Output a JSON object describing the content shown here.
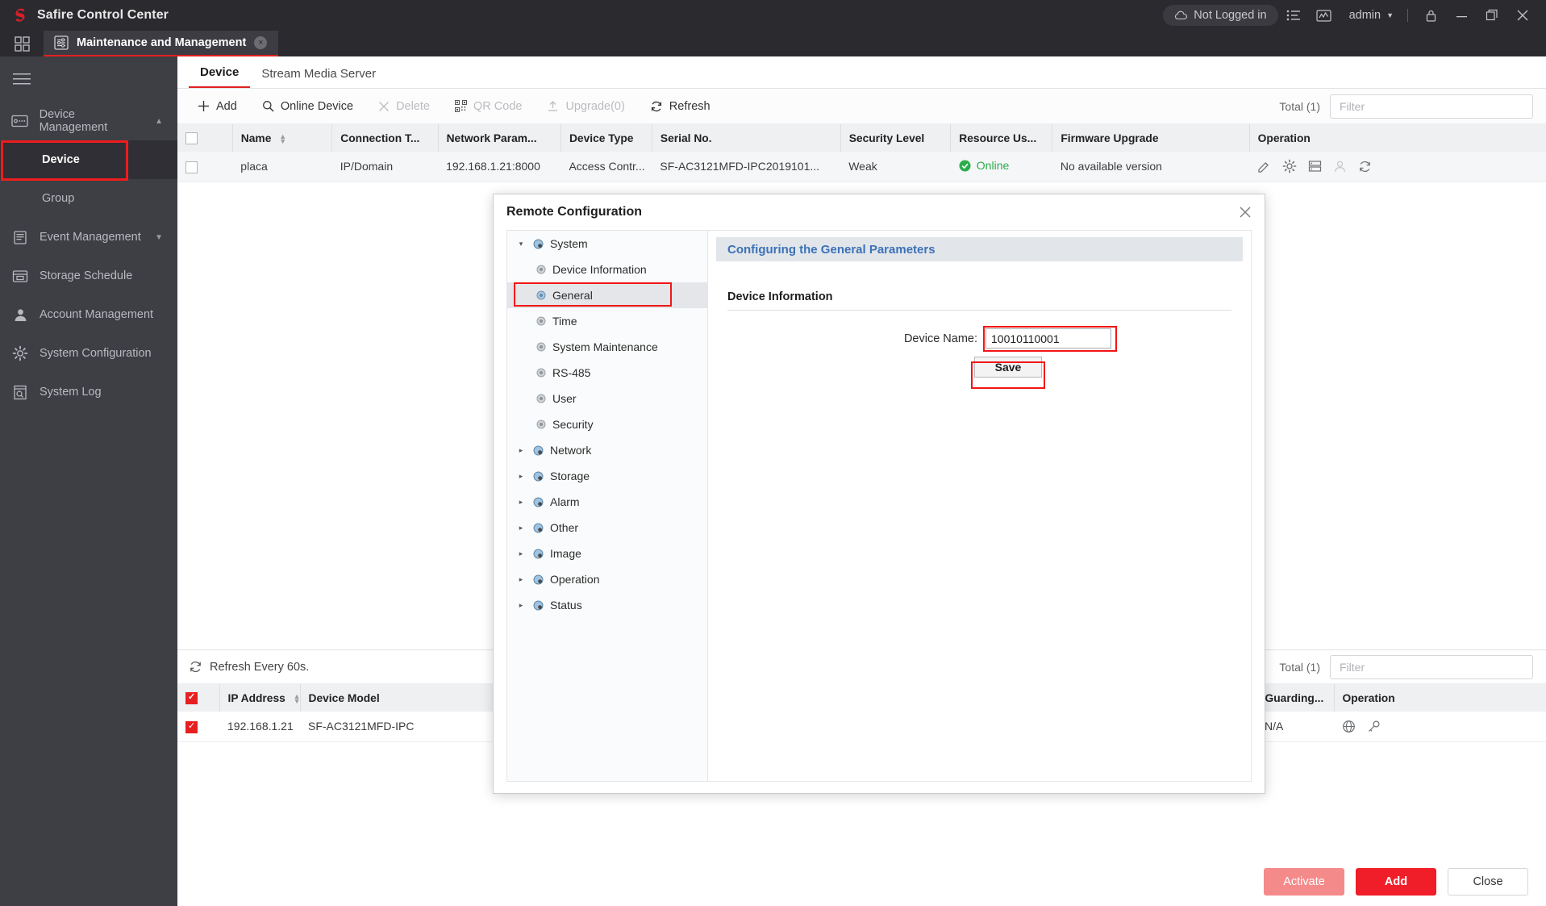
{
  "titlebar": {
    "app_title": "Safire Control Center",
    "logo_icon": "safire-s-logo",
    "cloud_status": "Not Logged in",
    "cloud_icon": "cloud-icon",
    "list_icon": "list-icon",
    "chart_icon": "chart-icon",
    "user_name": "admin",
    "lock_icon": "lock-icon",
    "minimize_icon": "minimize-icon",
    "maximize_icon": "maximize-icon",
    "close_icon": "close-icon"
  },
  "tabstrip": {
    "apps_icon": "grid-apps-icon",
    "tab_icon": "maintenance-icon",
    "tab_label": "Maintenance and Management",
    "tab_close": "×"
  },
  "sidebar": {
    "menu_icon": "hamburger-icon",
    "items": [
      {
        "label": "Device Management",
        "icon": "device-management-icon",
        "expanded": true,
        "caret": "▲"
      },
      {
        "label": "Device",
        "icon": "",
        "sub": true,
        "active": true
      },
      {
        "label": "Group",
        "icon": "",
        "sub": true,
        "active": false
      },
      {
        "label": "Event Management",
        "icon": "event-management-icon",
        "expanded": false,
        "caret": "▼"
      },
      {
        "label": "Storage Schedule",
        "icon": "storage-schedule-icon"
      },
      {
        "label": "Account Management",
        "icon": "account-management-icon"
      },
      {
        "label": "System Configuration",
        "icon": "system-configuration-icon"
      },
      {
        "label": "System Log",
        "icon": "system-log-icon"
      }
    ]
  },
  "content": {
    "tabs": [
      {
        "label": "Device",
        "active": true
      },
      {
        "label": "Stream Media Server",
        "active": false
      }
    ],
    "toolbar": [
      {
        "label": "Add",
        "icon": "plus-icon",
        "disabled": false
      },
      {
        "label": "Online Device",
        "icon": "search-icon",
        "disabled": false
      },
      {
        "label": "Delete",
        "icon": "x-icon",
        "disabled": true
      },
      {
        "label": "QR Code",
        "icon": "qrcode-icon",
        "disabled": true
      },
      {
        "label": "Upgrade(0)",
        "icon": "upload-icon",
        "disabled": true
      },
      {
        "label": "Refresh",
        "icon": "refresh-icon",
        "disabled": false
      }
    ],
    "total_label": "Total (1)",
    "filter_placeholder": "Filter",
    "filter_value": "",
    "table": {
      "columns": [
        "Name",
        "Connection T...",
        "Network Param...",
        "Device Type",
        "Serial No.",
        "Security Level",
        "Resource Us...",
        "Firmware Upgrade",
        "Operation"
      ],
      "rows": [
        {
          "checked": false,
          "name": "placa",
          "connection_type": "IP/Domain",
          "network_param": "192.168.1.21:8000",
          "device_type": "Access Contr...",
          "serial_no": "SF-AC3121MFD-IPC2019101...",
          "security_level": "Weak",
          "resource_usage": "Online",
          "firmware_upgrade": "No available version",
          "operation_icons": [
            "edit-icon",
            "remote-config-gear-icon",
            "server-icon",
            "user-icon",
            "refresh-icon"
          ]
        }
      ]
    }
  },
  "bottom_panel": {
    "refresh_icon": "refresh-icon",
    "refresh_label": "Refresh Every 60s.",
    "total_label": "Total (1)",
    "filter_placeholder": "Filter",
    "filter_value": "",
    "table": {
      "columns_left": [
        "IP Address",
        "Device Model"
      ],
      "columns_right": [
        "...",
        "Guarding...",
        "Operation"
      ],
      "header_checked": true,
      "rows": [
        {
          "checked": true,
          "ip_address": "192.168.1.21",
          "device_model": "SF-AC3121MFD-IPC",
          "guarding": "N/A",
          "operation_icons": [
            "globe-icon",
            "key-icon"
          ]
        }
      ]
    },
    "buttons": [
      {
        "label": "Activate",
        "style": "ghost"
      },
      {
        "label": "Add",
        "style": "primary"
      },
      {
        "label": "Close",
        "style": "outline"
      }
    ]
  },
  "modal": {
    "title": "Remote Configuration",
    "close_icon": "close-icon",
    "tree": [
      {
        "label": "System",
        "level": 0,
        "arrow": "▾",
        "icon": "system-node-icon",
        "selected": false
      },
      {
        "label": "Device Information",
        "level": 1,
        "arrow": "",
        "icon": "gear-node-icon",
        "selected": false
      },
      {
        "label": "General",
        "level": 1,
        "arrow": "",
        "icon": "gear-node-icon",
        "selected": true
      },
      {
        "label": "Time",
        "level": 1,
        "arrow": "",
        "icon": "gear-node-icon",
        "selected": false
      },
      {
        "label": "System Maintenance",
        "level": 1,
        "arrow": "",
        "icon": "gear-node-icon",
        "selected": false
      },
      {
        "label": "RS-485",
        "level": 1,
        "arrow": "",
        "icon": "gear-node-icon",
        "selected": false
      },
      {
        "label": "User",
        "level": 1,
        "arrow": "",
        "icon": "gear-node-icon",
        "selected": false
      },
      {
        "label": "Security",
        "level": 1,
        "arrow": "",
        "icon": "gear-node-icon",
        "selected": false
      },
      {
        "label": "Network",
        "level": 0,
        "arrow": "▸",
        "icon": "system-node-icon",
        "selected": false
      },
      {
        "label": "Storage",
        "level": 0,
        "arrow": "▸",
        "icon": "system-node-icon",
        "selected": false
      },
      {
        "label": "Alarm",
        "level": 0,
        "arrow": "▸",
        "icon": "system-node-icon",
        "selected": false
      },
      {
        "label": "Other",
        "level": 0,
        "arrow": "▸",
        "icon": "system-node-icon",
        "selected": false
      },
      {
        "label": "Image",
        "level": 0,
        "arrow": "▸",
        "icon": "system-node-icon",
        "selected": false
      },
      {
        "label": "Operation",
        "level": 0,
        "arrow": "▸",
        "icon": "system-node-icon",
        "selected": false
      },
      {
        "label": "Status",
        "level": 0,
        "arrow": "▸",
        "icon": "system-node-icon",
        "selected": false
      }
    ],
    "panel": {
      "banner": "Configuring the General Parameters",
      "section_title": "Device Information",
      "device_name_label": "Device Name:",
      "device_name_value": "10010110001",
      "save_label": "Save"
    }
  },
  "colors": {
    "accent_red": "#e02020",
    "brand_red": "#f01e28",
    "highlight_red": "#f21515",
    "online_green": "#2aae4a",
    "banner_blue": "#3b72b8",
    "sidebar_bg": "#3e3e45",
    "titlebar_bg": "#2b2b2f"
  }
}
